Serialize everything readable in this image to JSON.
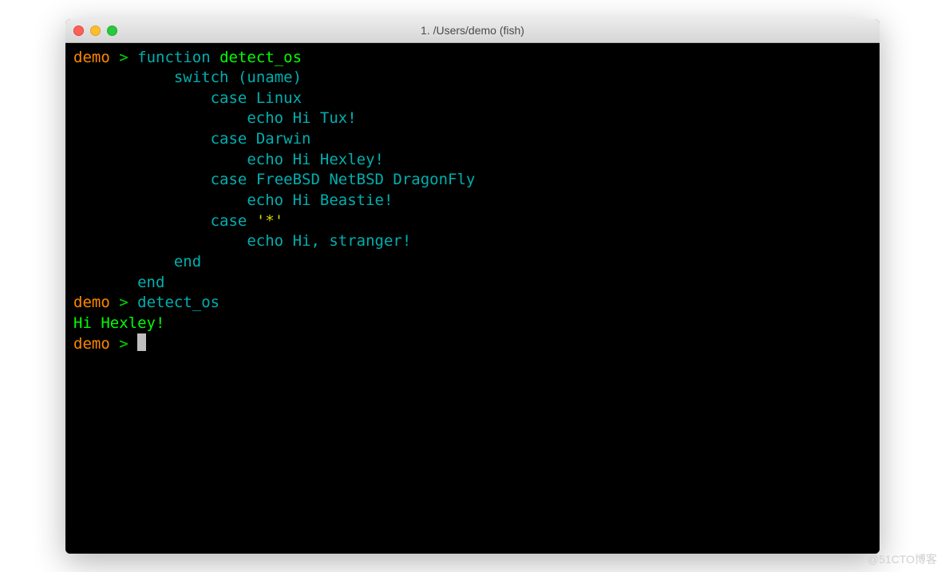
{
  "window": {
    "title": "1. /Users/demo (fish)"
  },
  "prompt": {
    "user": "demo",
    "arrow": ">"
  },
  "lines": {
    "l1_function": "function",
    "l1_name": "detect_os",
    "l2_switch": "switch",
    "l2_uname": "(uname)",
    "l3_case": "case",
    "l3_arg": "Linux",
    "l4_echo": "echo",
    "l4_hi": "Hi",
    "l4_rest": "Tux!",
    "l5_case": "case",
    "l5_arg": "Darwin",
    "l6_echo": "echo",
    "l6_hi": "Hi",
    "l6_rest": "Hexley!",
    "l7_case": "case",
    "l7_arg": "FreeBSD NetBSD DragonFly",
    "l8_echo": "echo",
    "l8_hi": "Hi",
    "l8_rest": "Beastie!",
    "l9_case": "case",
    "l9_arg": "'*'",
    "l10_echo": "echo",
    "l10_hi": "Hi,",
    "l10_rest": "stranger!",
    "l11_end": "end",
    "l12_end": "end",
    "l13_cmd": "detect_os",
    "l14_out": "Hi Hexley!"
  },
  "watermark": "@51CTO博客"
}
